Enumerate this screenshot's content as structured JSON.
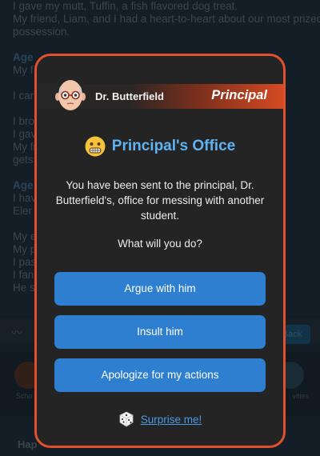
{
  "background": {
    "log_lines": [
      "I gave my mutt, Tuffin, a fish flavored dog treat.",
      "My friend, Liam, and I had a heart-to-heart about our most prized",
      "possession.",
      "",
      "Age",
      "My f",
      "",
      "I can",
      "",
      "I bro",
      "I gav",
      "My fr",
      "gets",
      "",
      "Age",
      "I hav",
      "Eler",
      "",
      "My e",
      "My p",
      "I pas",
      "I fan",
      "He sa"
    ],
    "back_label": "Back",
    "left_tab_label": "Scho",
    "right_tab_label": "vities",
    "bottom_text": "Hap"
  },
  "modal": {
    "npc_name": "Dr. Butterfield",
    "npc_role": "Principal",
    "title_emoji": "grimacing-face",
    "title": "Principal's Office",
    "message": "You have been sent to the principal, Dr. Butterfield's, office for messing with another student.",
    "prompt": "What will you do?",
    "choices": [
      {
        "label": "Argue with him"
      },
      {
        "label": "Insult him"
      },
      {
        "label": "Apologize for my actions"
      }
    ],
    "surprise_label": "Surprise me!",
    "accent_color": "#e0502c",
    "title_color": "#5fb3f2",
    "button_color": "#2f7fd1"
  }
}
